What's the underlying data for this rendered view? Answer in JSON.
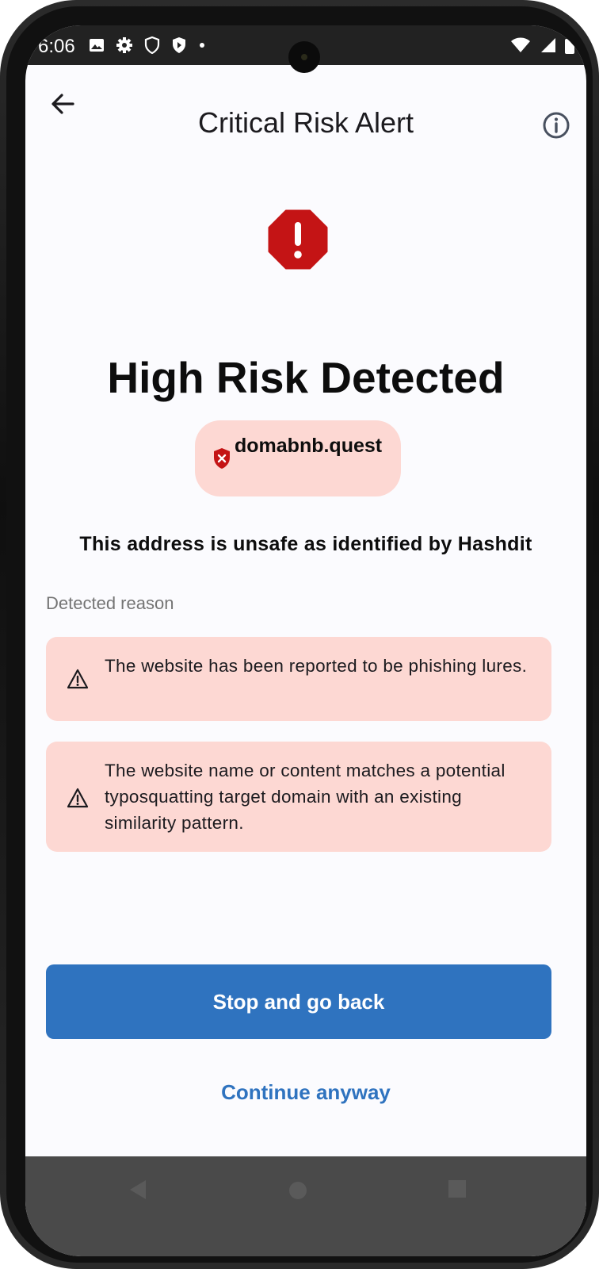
{
  "status_bar": {
    "time": "6:06",
    "left_icons": [
      "image-icon",
      "gear-icon",
      "shield-outline-icon",
      "shield-play-icon",
      "dot-icon"
    ],
    "right_icons": [
      "wifi-icon",
      "signal-icon",
      "battery-icon"
    ]
  },
  "app_bar": {
    "title": "Critical Risk Alert",
    "back_icon": "arrow-left-icon",
    "info_icon": "info-icon"
  },
  "alert": {
    "icon": "octagon-exclamation-icon",
    "headline": "High Risk Detected",
    "domain": "domabnb.quest",
    "domain_icon": "shield-x-icon",
    "message": "This address is unsafe as identified by Hashdit"
  },
  "reasons": {
    "label": "Detected reason",
    "items": [
      {
        "icon": "warning-icon",
        "text": "The website has been reported to be phishing lures."
      },
      {
        "icon": "warning-icon",
        "text": "The website name or content matches a potential typosquatting target domain with an existing similarity pattern."
      }
    ]
  },
  "actions": {
    "primary_label": "Stop and go back",
    "secondary_label": "Continue anyway"
  },
  "colors": {
    "danger": "#c41415",
    "card_bg": "#fdd8d3",
    "primary": "#2f73bf"
  }
}
